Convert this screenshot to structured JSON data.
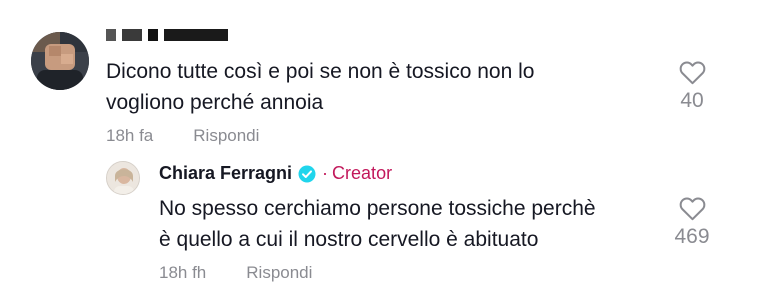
{
  "comment": {
    "text_lines": [
      "Dicono tutte così e poi se non è tossico non lo",
      "vogliono perché annoia"
    ],
    "timestamp": "18h fa",
    "reply_label": "Rispondi",
    "like_count": "40",
    "like_icon": "heart-outline-icon"
  },
  "reply": {
    "author": "Chiara Ferragni",
    "verified_icon": "verified-check-icon",
    "badge_separator": "·",
    "badge": "Creator",
    "text_lines": [
      "No spesso cerchiamo persone tossiche perchè",
      "è quello a cui il nostro cervello è abituato"
    ],
    "timestamp": "18h fh",
    "reply_label": "Rispondi",
    "like_count": "469",
    "like_icon": "heart-outline-icon"
  },
  "colors": {
    "text_primary": "#161823",
    "text_secondary": "#8a8b91",
    "creator_badge": "#c2185b",
    "verified": "#20d5ec"
  }
}
